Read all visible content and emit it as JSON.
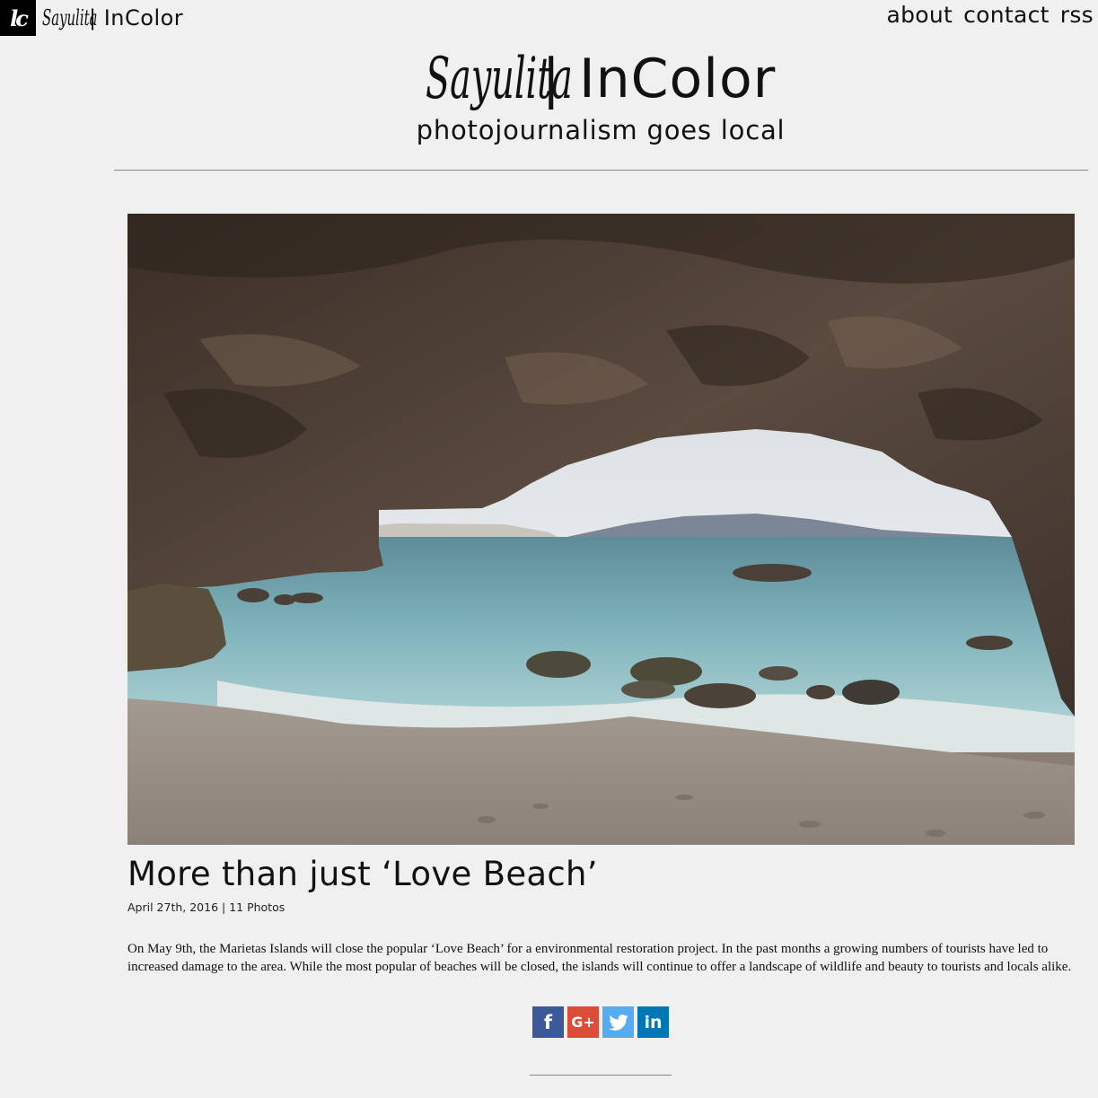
{
  "topbar": {
    "logo_text": "lc",
    "brand_script": "Sayulita",
    "brand_rest": "| InColor"
  },
  "nav": {
    "items": [
      "about",
      "contact",
      "rss"
    ]
  },
  "masthead": {
    "title_script": "Sayulita",
    "title_rest": "| InColor",
    "tagline": "photojournalism goes local"
  },
  "post": {
    "title": "More than just ‘Love Beach’",
    "meta": "April 27th, 2016 | 11 Photos",
    "body": "On May 9th, the Marietas Islands will close the popular ‘Love Beach’ for a environmental restoration project. In the past months a growing numbers of tourists have led to increased damage to the area. While the most popular of beaches will be closed, the islands will continue to offer a landscape of wildlife and beauty to tourists and locals alike."
  },
  "share": {
    "facebook_glyph": "f",
    "googleplus_glyph": "G+",
    "linkedin_glyph": "in"
  },
  "icons": {
    "logo": "logo-monogram-icon",
    "facebook": "facebook-icon",
    "googleplus": "google-plus-icon",
    "twitter": "twitter-icon",
    "linkedin": "linkedin-icon"
  },
  "colors": {
    "background": "#f0f0f0",
    "facebook": "#3b5998",
    "googleplus": "#dd4b39",
    "twitter": "#55acee",
    "linkedin": "#0077b5"
  }
}
